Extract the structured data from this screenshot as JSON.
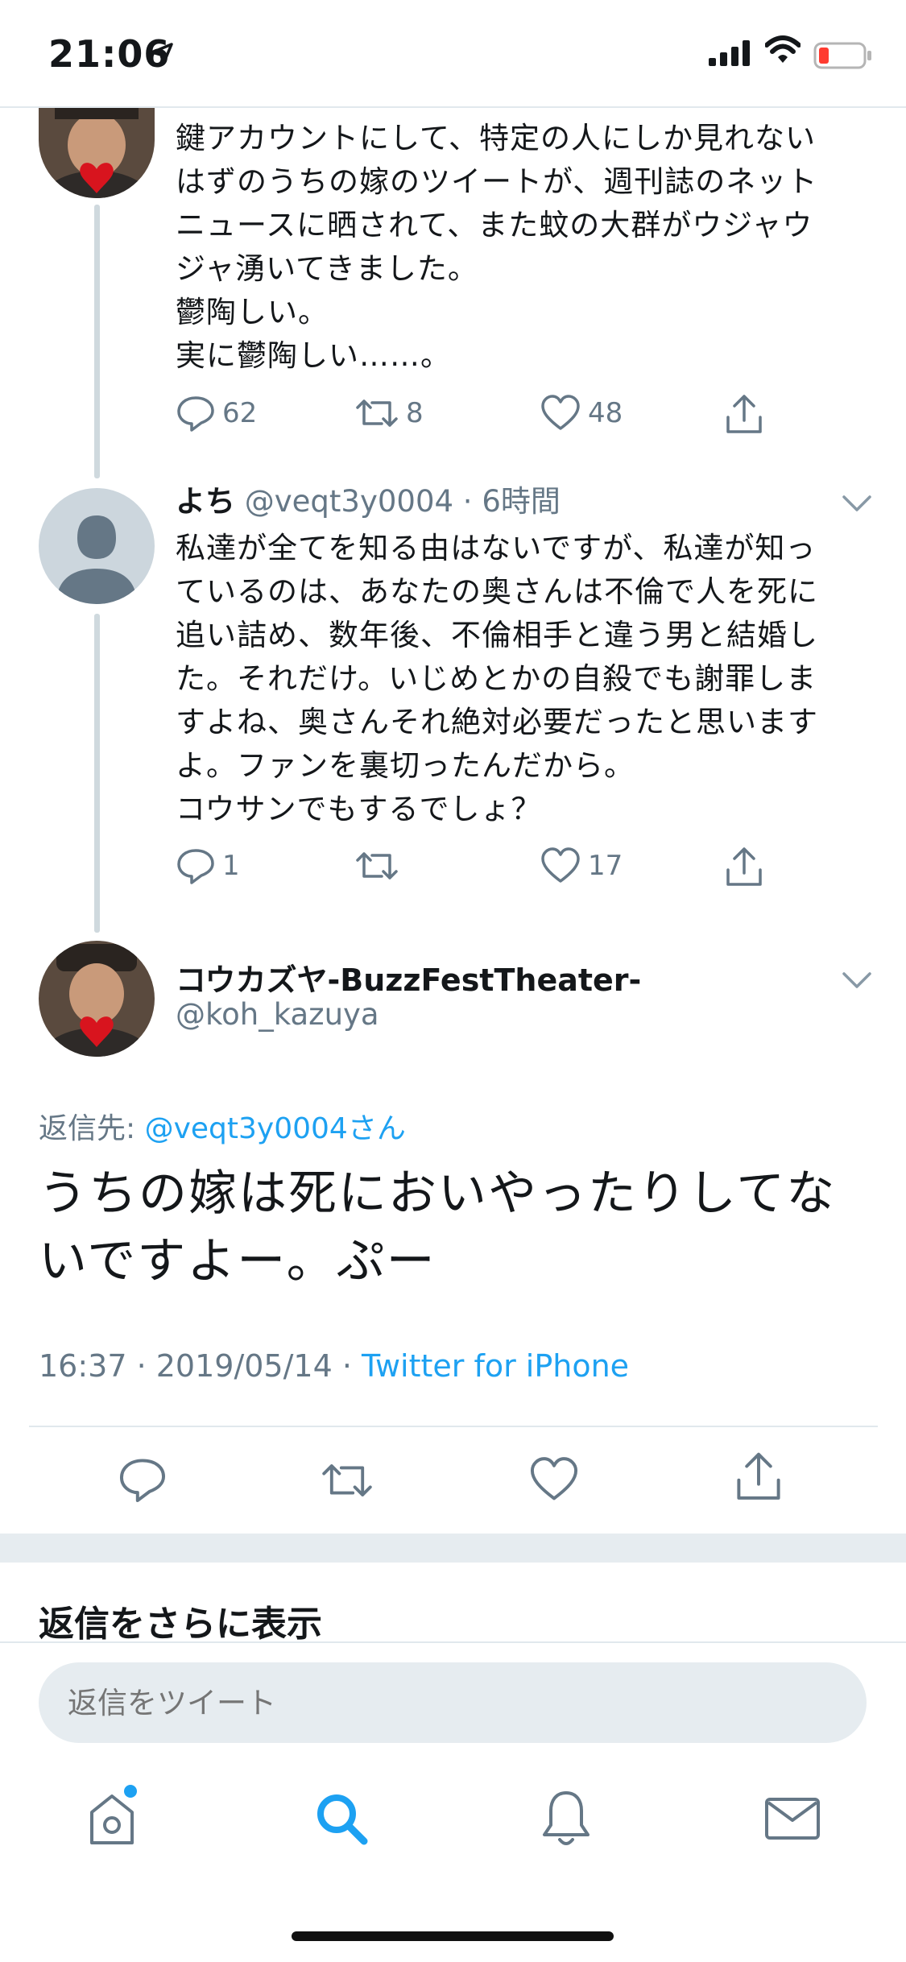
{
  "status_bar": {
    "time": "21:06"
  },
  "tweet1": {
    "text": "鍵アカウントにして、特定の人にしか見れない\nはずのうちの嫁のツイートが、週刊誌のネット\nニュースに晒されて、また蚊の大群がウジャウ\nジャ湧いてきました。\n鬱陶しい。\n実に鬱陶しい……。",
    "replies": "62",
    "retweets": "8",
    "likes": "48"
  },
  "tweet2": {
    "name": "よち",
    "handle": "@veqt3y0004",
    "time": "· 6時間",
    "text": "私達が全てを知る由はないですが、私達が知っ\nているのは、あなたの奥さんは不倫で人を死に\n追い詰め、数年後、不倫相手と違う男と結婚し\nた。それだけ。いじめとかの自殺でも謝罪しま\nすよね、奥さんそれ絶対必要だったと思います\nよ。ファンを裏切ったんだから。\nコウサンでもするでしょ？",
    "replies": "1",
    "retweets": "",
    "likes": "17"
  },
  "main_tweet": {
    "name": "コウカズヤ-BuzzFestTheater-",
    "handle": "@koh_kazuya",
    "reply_prefix": "返信先: ",
    "reply_target": "@veqt3y0004さん",
    "text": "うちの嫁は死においやったりしてな\nいですよー。ぷー",
    "time_date": "16:37 · 2019/05/14 · ",
    "source": "Twitter for iPhone"
  },
  "more_replies_label": "返信をさらに表示",
  "compose": {
    "placeholder": "返信をツイート"
  },
  "tab_bar": {
    "items": [
      "home",
      "search",
      "notifications",
      "messages"
    ]
  },
  "colors": {
    "accent": "#1da1f2",
    "secondary_text": "#657786",
    "divider": "#e1e8ed"
  }
}
